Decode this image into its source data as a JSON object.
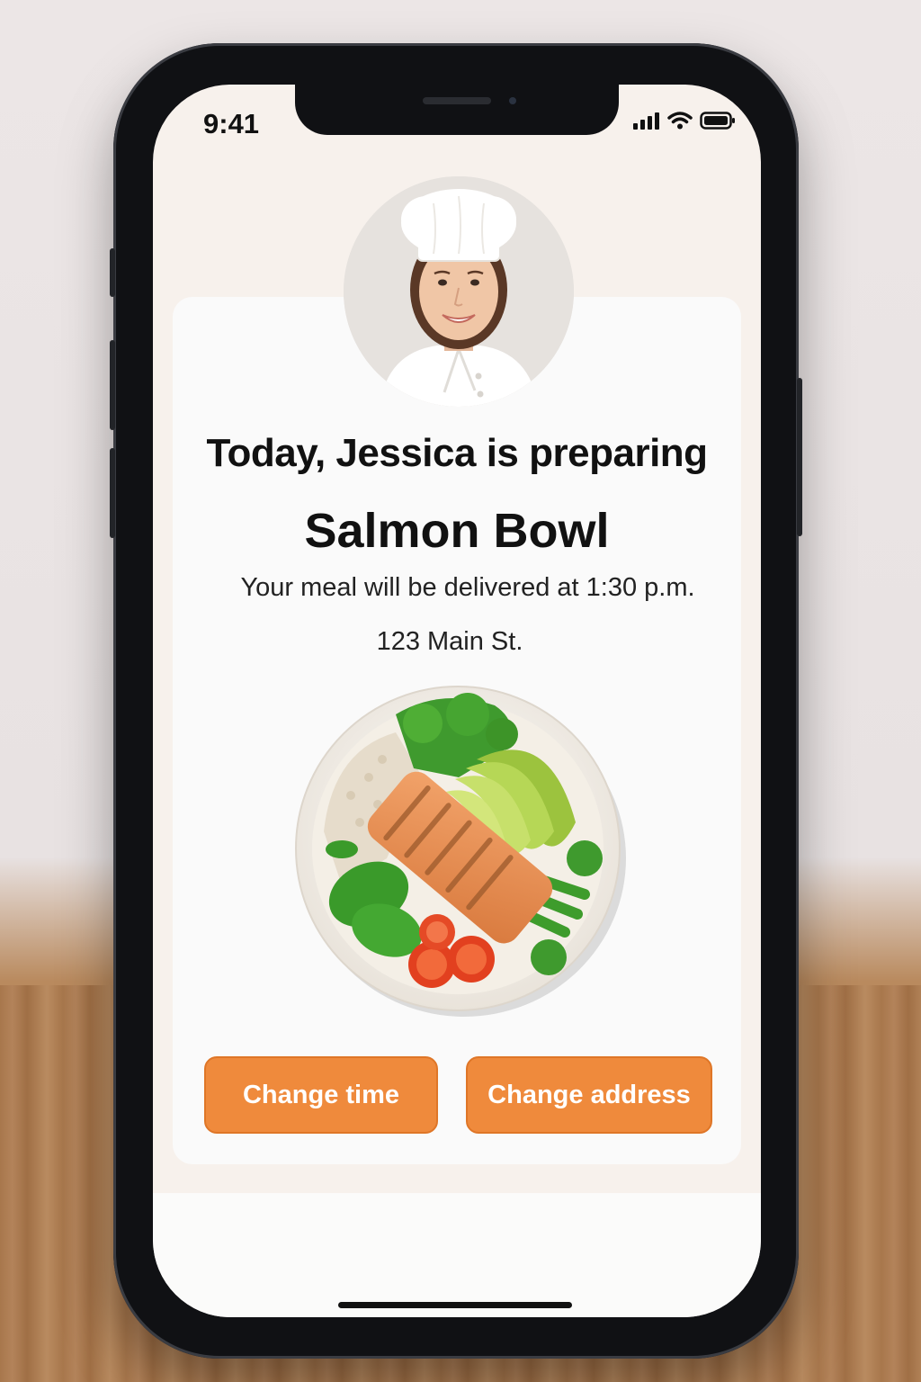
{
  "status_bar": {
    "time": "9:41",
    "icons": [
      "cellular-signal-icon",
      "wifi-icon",
      "battery-icon"
    ]
  },
  "chef": {
    "avatar_icon": "chef-portrait"
  },
  "order": {
    "title": "Today, Jessica is preparing",
    "dish": "Salmon Bowl",
    "delivery_text": "Your meal will be delivered at 1:30 p.m.",
    "address": "123 Main St.",
    "dish_image_icon": "salmon-bowl-image"
  },
  "actions": {
    "change_time": "Change time",
    "change_address": "Change address"
  },
  "colors": {
    "accent": "#ef8a3c",
    "screen_bg": "#f7f1ec",
    "card_bg": "#fafafa"
  }
}
